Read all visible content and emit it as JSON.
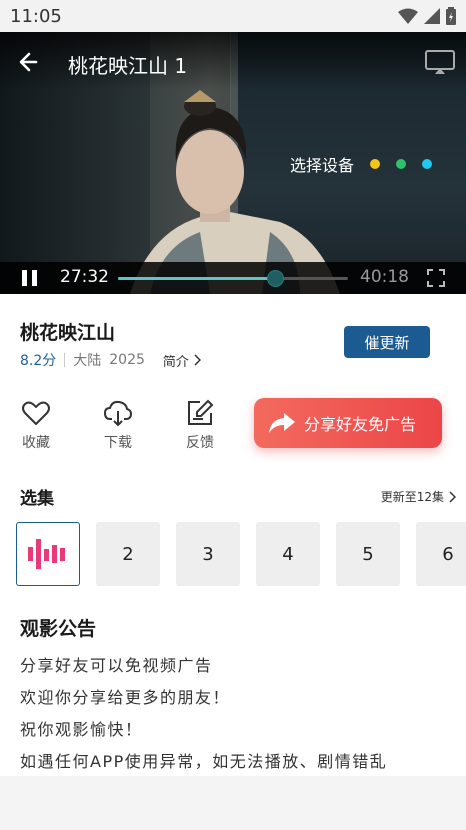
{
  "status_bar": {
    "time": "11:05"
  },
  "player": {
    "title": "桃花映江山 1",
    "device_select_label": "选择设备",
    "dots": [
      "#f5c518",
      "#2bc46a",
      "#1ec8f0"
    ],
    "current_time": "27:32",
    "total_time": "40:18",
    "progress": 0.6833
  },
  "show": {
    "title": "桃花映江山",
    "score": "8.2分",
    "region": "大陆",
    "year": "2025",
    "intro_label": "简介",
    "urge_button": "催更新"
  },
  "actions": [
    {
      "label": "收藏",
      "icon": "heart-icon"
    },
    {
      "label": "下载",
      "icon": "download-icon"
    },
    {
      "label": "反馈",
      "icon": "feedback-icon"
    }
  ],
  "share_button": "分享好友免广告",
  "episodes": {
    "title": "选集",
    "more": "更新至12集",
    "items": [
      "1",
      "2",
      "3",
      "4",
      "5",
      "6"
    ],
    "active_index": 0
  },
  "notice": {
    "title": "观影公告",
    "lines": [
      "分享好友可以免视频广告",
      "欢迎你分享给更多的朋友！",
      "祝你观影愉快！",
      "如遇任何APP使用异常，如无法播放、剧情错乱"
    ]
  },
  "colors": {
    "accent": "#1c5a92",
    "progress": "#5ec4c4",
    "share": "#ec4548",
    "equalizer": "#e8397a"
  }
}
